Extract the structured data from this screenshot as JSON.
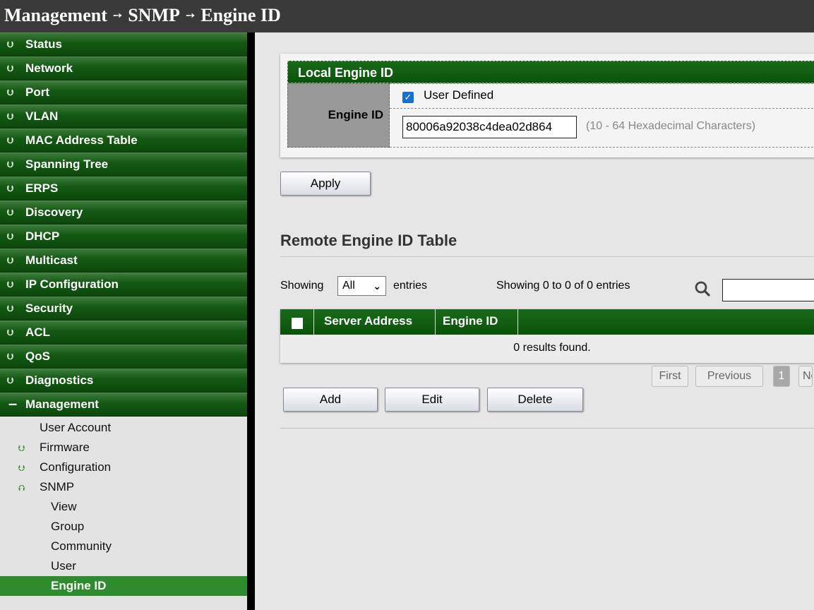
{
  "breadcrumb": {
    "part1": "Management",
    "part2": "SNMP",
    "part3": "Engine ID",
    "separator": "➙"
  },
  "sidebar": {
    "items": [
      {
        "label": "Status"
      },
      {
        "label": "Network"
      },
      {
        "label": "Port"
      },
      {
        "label": "VLAN"
      },
      {
        "label": "MAC Address Table"
      },
      {
        "label": "Spanning Tree"
      },
      {
        "label": "ERPS"
      },
      {
        "label": "Discovery"
      },
      {
        "label": "DHCP"
      },
      {
        "label": "Multicast"
      },
      {
        "label": "IP Configuration"
      },
      {
        "label": "Security"
      },
      {
        "label": "ACL"
      },
      {
        "label": "QoS"
      },
      {
        "label": "Diagnostics"
      },
      {
        "label": "Management"
      }
    ],
    "management_sub": [
      {
        "label": "User Account"
      },
      {
        "label": "Firmware"
      },
      {
        "label": "Configuration"
      },
      {
        "label": "SNMP"
      }
    ],
    "snmp_sub": [
      {
        "label": "View"
      },
      {
        "label": "Group"
      },
      {
        "label": "Community"
      },
      {
        "label": "User"
      },
      {
        "label": "Engine ID"
      }
    ]
  },
  "local": {
    "header": "Local Engine ID",
    "engine_id_label": "Engine ID",
    "user_defined_label": "User Defined",
    "user_defined_checked": true,
    "engine_id_value": "80006a92038c4dea02d864",
    "engine_id_hint": "(10 - 64 Hexadecimal Characters)"
  },
  "apply_label": "Apply",
  "remote": {
    "title": "Remote Engine ID Table",
    "showing_label": "Showing",
    "entries_select": "All",
    "entries_label": "entries",
    "info": "Showing 0 to 0 of 0 entries",
    "columns": [
      "Server Address",
      "Engine ID"
    ],
    "empty_text": "0 results found.",
    "pagination": {
      "first": "First",
      "previous": "Previous",
      "page": "1",
      "next": "Next"
    }
  },
  "actions": {
    "add": "Add",
    "edit": "Edit",
    "delete": "Delete"
  }
}
